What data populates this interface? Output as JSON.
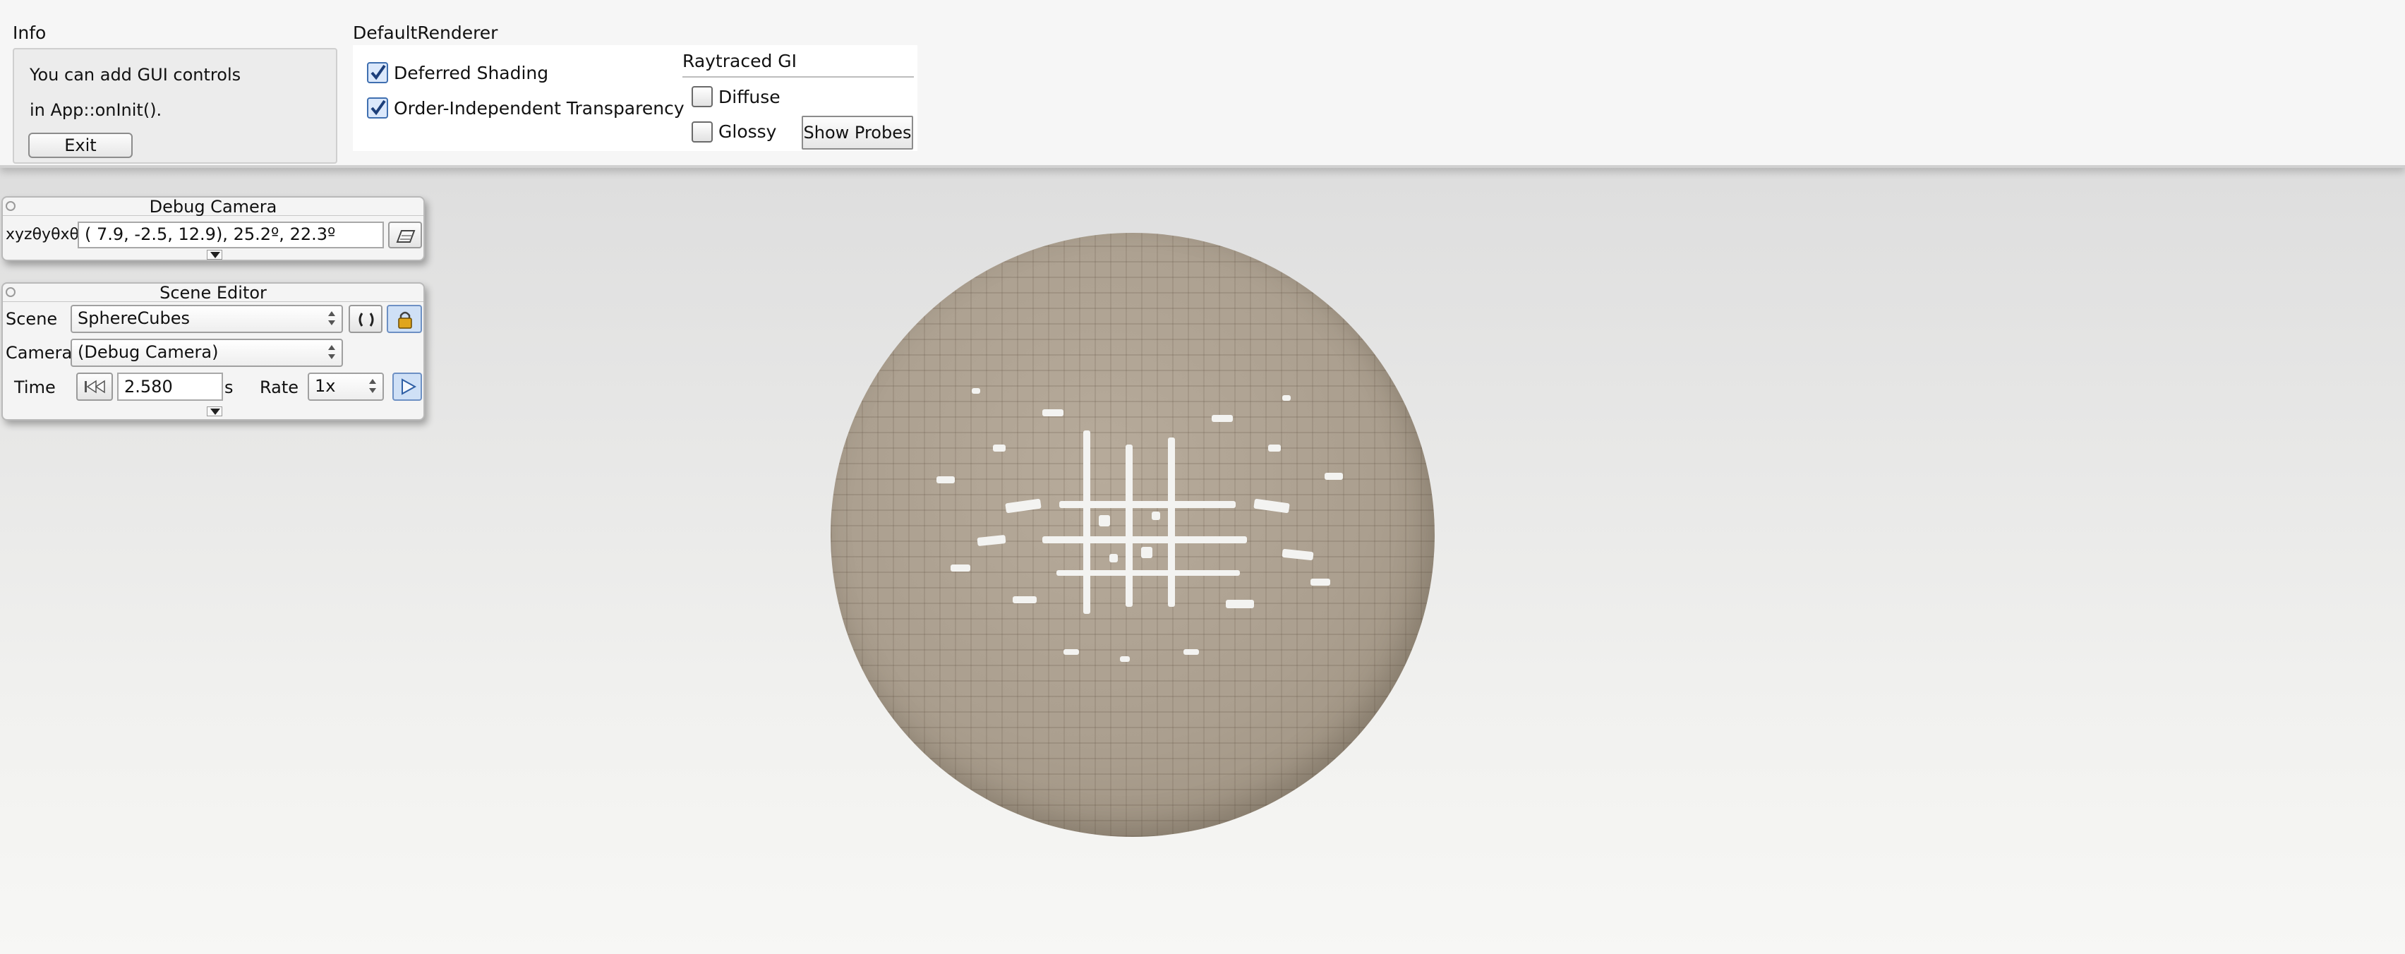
{
  "info": {
    "title": "Info",
    "line1": "You can add GUI controls",
    "line2": "in App::onInit().",
    "exit_label": "Exit"
  },
  "renderer": {
    "title": "DefaultRenderer",
    "deferred_shading": {
      "label": "Deferred Shading",
      "checked": true
    },
    "oit": {
      "label": "Order-Independent Transparency",
      "checked": true
    },
    "raytraced_gi": {
      "title": "Raytraced GI",
      "diffuse": {
        "label": "Diffuse",
        "checked": false
      },
      "glossy": {
        "label": "Glossy",
        "checked": false
      },
      "show_probes_label": "Show Probes"
    }
  },
  "debug_camera": {
    "title": "Debug Camera",
    "coord_label": "xyzθyθxθz",
    "coord_value": "(  7.9,  -2.5,  12.9),  25.2º,  22.3º"
  },
  "scene_editor": {
    "title": "Scene Editor",
    "scene_label": "Scene",
    "scene_value": "SphereCubes",
    "camera_label": "Camera",
    "camera_value": "(Debug Camera)",
    "time_label": "Time",
    "time_value": "2.580",
    "time_unit": "s",
    "rate_label": "Rate",
    "rate_value": "1x"
  },
  "colors": {
    "accent": "#3f6fb0",
    "sphere": "#ab9f8f",
    "background": "#e8e8e7"
  }
}
